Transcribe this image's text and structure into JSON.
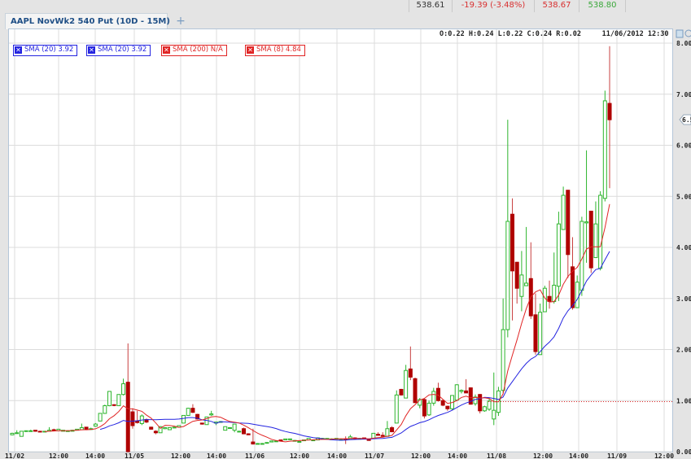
{
  "quote_bar": {
    "last": "538.61",
    "change": "-19.39 (-3.48%)",
    "bid": "538.67",
    "ask": "538.80",
    "colors": {
      "neutral": "#333333",
      "down": "#d83030",
      "up": "#3aa83a"
    }
  },
  "tabs": [
    {
      "label": "AAPL NovWk2 540 Put (10D - 15M)"
    }
  ],
  "add_tab_label": "+",
  "ohlc_readout": "O:0.22 H:0.24 L:0.22 C:0.24 R:0.02",
  "timestamp": "11/06/2012 12:30",
  "legend": [
    {
      "label": "SMA (20) 3.92",
      "color": "#2424e0"
    },
    {
      "label": "SMA (20) 3.92",
      "color": "#2424e0"
    },
    {
      "label": "SMA (200) N/A",
      "color": "#e02424"
    },
    {
      "label": "SMA (8) 4.84",
      "color": "#e02424"
    }
  ],
  "icons": [
    "close-x-icon",
    "panel-toggle-icon",
    "settings-icon"
  ],
  "chart_data": {
    "type": "candlestick",
    "interval": "15M",
    "y_ticks": [
      "8.00",
      "7.00",
      "6.00",
      "5.00",
      "4.00",
      "3.00",
      "2.00",
      "1.00",
      "0.00"
    ],
    "ylim": [
      0,
      8
    ],
    "x_ticks": [
      "11/02",
      "12:00",
      "14:00",
      "11/05",
      "12:00",
      "14:00",
      "11/06",
      "12:00",
      "14:00",
      "11/07",
      "12:00",
      "14:00",
      "11/08",
      "12:00",
      "14:00",
      "11/09",
      "12:00"
    ],
    "grid": true,
    "current_price_label": "6.5",
    "reference_line": 0.98,
    "colors": {
      "up": "#2db52d",
      "down": "#b00000",
      "sma20": "#2424e0",
      "sma8": "#e02424"
    },
    "ohlc": [
      [
        0.33,
        0.37,
        0.32,
        0.36
      ],
      [
        0.36,
        0.42,
        0.35,
        0.37
      ],
      [
        0.3,
        0.4,
        0.3,
        0.4
      ],
      [
        0.4,
        0.41,
        0.39,
        0.41
      ],
      [
        0.41,
        0.43,
        0.4,
        0.41
      ],
      [
        0.42,
        0.42,
        0.39,
        0.4
      ],
      [
        0.4,
        0.4,
        0.39,
        0.39
      ],
      [
        0.39,
        0.4,
        0.39,
        0.4
      ],
      [
        0.4,
        0.48,
        0.4,
        0.42
      ],
      [
        0.43,
        0.45,
        0.4,
        0.41
      ],
      [
        0.41,
        0.44,
        0.41,
        0.44
      ],
      [
        0.4,
        0.42,
        0.4,
        0.42
      ],
      [
        0.41,
        0.42,
        0.4,
        0.41
      ],
      [
        0.4,
        0.43,
        0.4,
        0.42
      ],
      [
        0.42,
        0.44,
        0.42,
        0.44
      ],
      [
        0.43,
        0.55,
        0.43,
        0.47
      ],
      [
        0.48,
        0.48,
        0.42,
        0.43
      ],
      [
        0.45,
        0.47,
        0.44,
        0.45
      ],
      [
        0.5,
        0.56,
        0.49,
        0.54
      ],
      [
        0.6,
        0.75,
        0.6,
        0.75
      ],
      [
        0.75,
        0.92,
        0.74,
        0.9
      ],
      [
        0.9,
        1.18,
        0.89,
        1.18
      ],
      [
        0.92,
        0.93,
        0.89,
        0.91
      ],
      [
        0.9,
        1.12,
        0.9,
        1.12
      ],
      [
        1.12,
        1.43,
        1.1,
        1.33
      ],
      [
        1.36,
        2.12,
        0.0,
        0.0
      ],
      [
        0.78,
        0.85,
        0.45,
        0.51
      ],
      [
        0.6,
        0.8,
        0.55,
        0.57
      ],
      [
        0.55,
        0.73,
        0.52,
        0.7
      ],
      [
        0.63,
        0.65,
        0.56,
        0.58
      ],
      [
        0.48,
        0.49,
        0.43,
        0.44
      ],
      [
        0.4,
        0.42,
        0.34,
        0.37
      ],
      [
        0.37,
        0.5,
        0.37,
        0.49
      ],
      [
        0.45,
        0.48,
        0.44,
        0.47
      ],
      [
        0.43,
        0.47,
        0.43,
        0.47
      ],
      [
        0.47,
        0.49,
        0.47,
        0.48
      ],
      [
        0.48,
        0.51,
        0.48,
        0.51
      ],
      [
        0.56,
        0.71,
        0.56,
        0.71
      ],
      [
        0.71,
        0.86,
        0.71,
        0.85
      ],
      [
        0.85,
        0.93,
        0.76,
        0.77
      ],
      [
        0.73,
        0.74,
        0.63,
        0.64
      ],
      [
        0.56,
        0.56,
        0.53,
        0.54
      ],
      [
        0.53,
        0.68,
        0.53,
        0.68
      ],
      [
        0.72,
        0.8,
        0.7,
        0.74
      ],
      [
        0.56,
        0.58,
        0.52,
        0.58
      ],
      [
        0.58,
        0.6,
        0.57,
        0.59
      ],
      [
        0.42,
        0.49,
        0.42,
        0.49
      ],
      [
        0.46,
        0.48,
        0.46,
        0.47
      ],
      [
        0.42,
        0.54,
        0.38,
        0.54
      ],
      [
        0.4,
        0.41,
        0.39,
        0.4
      ],
      [
        0.45,
        0.47,
        0.34,
        0.35
      ],
      [
        0.35,
        0.36,
        0.33,
        0.33
      ],
      [
        0.19,
        0.45,
        0.14,
        0.15
      ],
      [
        0.16,
        0.17,
        0.16,
        0.16
      ],
      [
        0.16,
        0.17,
        0.15,
        0.16
      ],
      [
        0.17,
        0.18,
        0.17,
        0.18
      ],
      [
        0.19,
        0.21,
        0.19,
        0.21
      ],
      [
        0.21,
        0.22,
        0.21,
        0.21
      ],
      [
        0.23,
        0.23,
        0.21,
        0.22
      ],
      [
        0.23,
        0.25,
        0.23,
        0.25
      ],
      [
        0.24,
        0.25,
        0.24,
        0.25
      ],
      [
        0.22,
        0.23,
        0.22,
        0.22
      ],
      [
        0.2,
        0.21,
        0.2,
        0.2
      ],
      [
        0.22,
        0.23,
        0.22,
        0.23
      ],
      [
        0.23,
        0.26,
        0.23,
        0.26
      ],
      [
        0.23,
        0.24,
        0.23,
        0.23
      ],
      [
        0.23,
        0.28,
        0.23,
        0.27
      ],
      [
        0.26,
        0.27,
        0.26,
        0.26
      ],
      [
        0.25,
        0.26,
        0.25,
        0.26
      ],
      [
        0.25,
        0.26,
        0.25,
        0.25
      ],
      [
        0.25,
        0.26,
        0.25,
        0.26
      ],
      [
        0.24,
        0.25,
        0.24,
        0.24
      ],
      [
        0.25,
        0.3,
        0.15,
        0.24
      ],
      [
        0.24,
        0.33,
        0.24,
        0.29
      ],
      [
        0.27,
        0.28,
        0.25,
        0.26
      ],
      [
        0.26,
        0.27,
        0.26,
        0.26
      ],
      [
        0.27,
        0.27,
        0.25,
        0.25
      ],
      [
        0.25,
        0.25,
        0.22,
        0.22
      ],
      [
        0.26,
        0.36,
        0.26,
        0.36
      ],
      [
        0.34,
        0.38,
        0.32,
        0.32
      ],
      [
        0.32,
        0.38,
        0.3,
        0.3
      ],
      [
        0.3,
        0.6,
        0.3,
        0.45
      ],
      [
        0.47,
        0.5,
        0.38,
        0.39
      ],
      [
        0.56,
        1.2,
        0.56,
        1.11
      ],
      [
        1.22,
        1.23,
        1.1,
        1.11
      ],
      [
        1.05,
        1.7,
        1.05,
        1.59
      ],
      [
        1.62,
        2.06,
        1.4,
        1.46
      ],
      [
        1.43,
        1.45,
        0.95,
        0.96
      ],
      [
        0.91,
        1.05,
        0.85,
        1.02
      ],
      [
        1.02,
        1.05,
        0.65,
        0.7
      ],
      [
        0.72,
        1.0,
        0.7,
        0.95
      ],
      [
        0.95,
        1.25,
        0.9,
        1.18
      ],
      [
        1.24,
        1.35,
        0.98,
        1.0
      ],
      [
        1.0,
        1.02,
        0.89,
        0.91
      ],
      [
        0.89,
        0.9,
        0.8,
        0.84
      ],
      [
        0.84,
        1.1,
        0.82,
        1.1
      ],
      [
        1.01,
        1.32,
        1.0,
        1.31
      ],
      [
        1.18,
        1.22,
        1.14,
        1.2
      ],
      [
        1.19,
        1.42,
        1.15,
        1.15
      ],
      [
        1.25,
        1.26,
        0.92,
        0.93
      ],
      [
        0.94,
        1.12,
        0.9,
        1.07
      ],
      [
        1.12,
        1.13,
        0.75,
        0.8
      ],
      [
        0.8,
        0.9,
        0.78,
        0.88
      ],
      [
        0.83,
        1.05,
        0.8,
        0.99
      ],
      [
        0.64,
        1.55,
        0.52,
        0.81
      ],
      [
        0.77,
        1.27,
        0.7,
        1.19
      ],
      [
        1.2,
        3.0,
        1.15,
        2.39
      ],
      [
        2.39,
        6.5,
        2.24,
        4.51
      ],
      [
        4.65,
        4.96,
        2.57,
        3.54
      ],
      [
        3.71,
        3.71,
        2.9,
        3.2
      ],
      [
        3.04,
        3.93,
        2.75,
        3.46
      ],
      [
        3.25,
        4.4,
        3.25,
        3.3
      ],
      [
        3.39,
        4.1,
        2.6,
        2.66
      ],
      [
        2.68,
        3.1,
        1.9,
        1.96
      ],
      [
        1.9,
        2.9,
        1.9,
        2.73
      ],
      [
        2.74,
        3.25,
        2.74,
        3.2
      ],
      [
        3.04,
        3.35,
        2.8,
        2.94
      ],
      [
        2.94,
        3.9,
        2.9,
        3.26
      ],
      [
        3.24,
        4.7,
        2.95,
        4.46
      ],
      [
        4.35,
        5.19,
        4.35,
        5.02
      ],
      [
        5.12,
        5.12,
        3.4,
        3.86
      ],
      [
        3.62,
        4.2,
        2.78,
        2.82
      ],
      [
        2.82,
        3.45,
        2.82,
        3.32
      ],
      [
        3.16,
        4.6,
        3.05,
        4.51
      ],
      [
        4.48,
        5.9,
        3.7,
        4.5
      ],
      [
        4.71,
        4.71,
        3.5,
        3.6
      ],
      [
        3.8,
        4.9,
        3.8,
        4.46
      ],
      [
        3.59,
        5.1,
        3.55,
        5.02
      ],
      [
        4.96,
        7.07,
        4.9,
        6.87
      ],
      [
        6.82,
        7.94,
        5.16,
        6.5
      ]
    ],
    "sma_periods": [
      20,
      8
    ]
  }
}
